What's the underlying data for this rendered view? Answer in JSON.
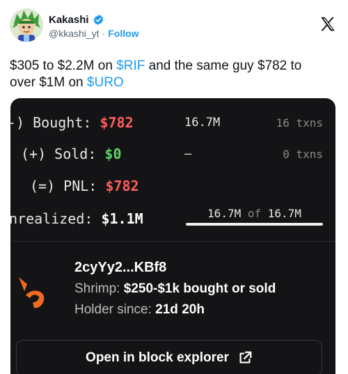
{
  "post": {
    "display_name": "Kakashi",
    "handle": "@kkashi_yt",
    "separator": "·",
    "follow_label": "Follow",
    "text_line1_a": "$305 to $2.2M on ",
    "cashtag1": "$RIF",
    "text_line1_b": " and the same guy $782 to",
    "text_line2_a": "over $1M on ",
    "cashtag2": "$URO"
  },
  "card": {
    "bought_label": "-) Bought:",
    "bought_value": "$782",
    "bought_tokens": "16.7M",
    "bought_txns": "16 txns",
    "sold_label": "(+) Sold:",
    "sold_value": "$0",
    "sold_tokens": "–",
    "sold_txns": "0 txns",
    "pnl_label": "(=) PNL:",
    "pnl_value": "$782",
    "unrealized_label": "nrealized:",
    "unrealized_value": "$1.1M",
    "held_amount": "16.7M",
    "held_of": "of",
    "held_total": "16.7M",
    "held_fraction": 1.0,
    "wallet_address": "2cyYy2...KBf8",
    "tier_label": "Shrimp:",
    "tier_value": "$250-$1k bought or sold",
    "holder_label": "Holder since:",
    "holder_value": "21d 20h",
    "explorer_label": "Open in block explorer"
  },
  "colors": {
    "accent": "#1d9bf0",
    "loss": "#ff5c5c",
    "gain": "#5ed36a",
    "card_bg": "#141416",
    "wallet_icon": "#f26a21"
  },
  "icons": {
    "verified": "verified-badge-icon",
    "brand": "x-logo-icon",
    "external": "external-link-icon",
    "wallet": "shrimp-icon"
  }
}
